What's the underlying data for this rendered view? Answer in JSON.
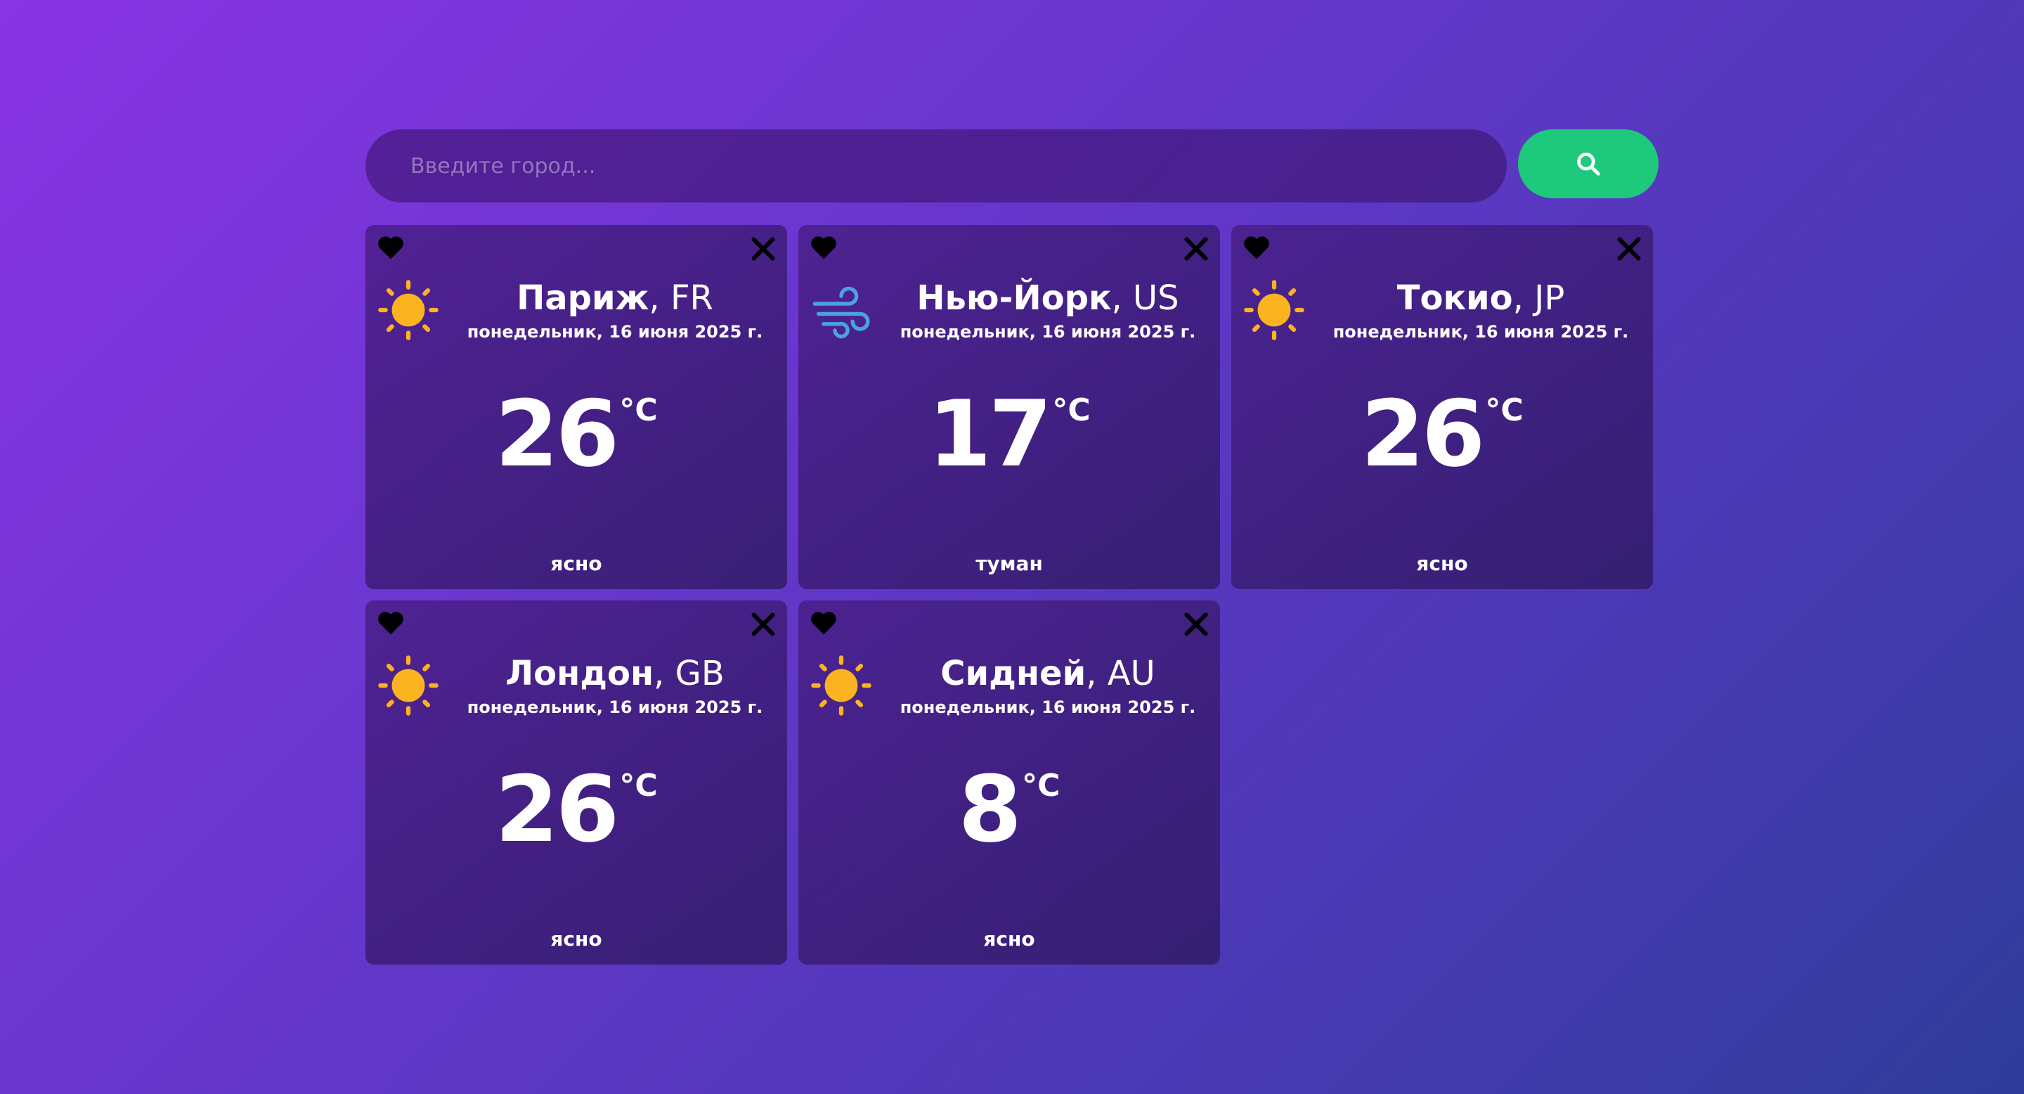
{
  "search": {
    "placeholder": "Введите город...",
    "button_icon": "search-icon"
  },
  "colors": {
    "accent": "#1ec97b",
    "sun": "#fbb320",
    "wind": "#4aa3e0"
  },
  "cards": [
    {
      "city": "Париж",
      "country": ", FR",
      "date": "понедельник, 16 июня 2025 г.",
      "temp": "26",
      "unit": "°C",
      "desc": "ясно",
      "icon": "sun-icon"
    },
    {
      "city": "Нью-Йорк",
      "country": ", US",
      "date": "понедельник, 16 июня 2025 г.",
      "temp": "17",
      "unit": "°C",
      "desc": "туман",
      "icon": "wind-icon"
    },
    {
      "city": "Токио",
      "country": ", JP",
      "date": "понедельник, 16 июня 2025 г.",
      "temp": "26",
      "unit": "°C",
      "desc": "ясно",
      "icon": "sun-icon"
    },
    {
      "city": "Лондон",
      "country": ", GB",
      "date": "понедельник, 16 июня 2025 г.",
      "temp": "26",
      "unit": "°C",
      "desc": "ясно",
      "icon": "sun-icon"
    },
    {
      "city": "Сидней",
      "country": ", AU",
      "date": "понедельник, 16 июня 2025 г.",
      "temp": "8",
      "unit": "°C",
      "desc": "ясно",
      "icon": "sun-icon"
    }
  ]
}
